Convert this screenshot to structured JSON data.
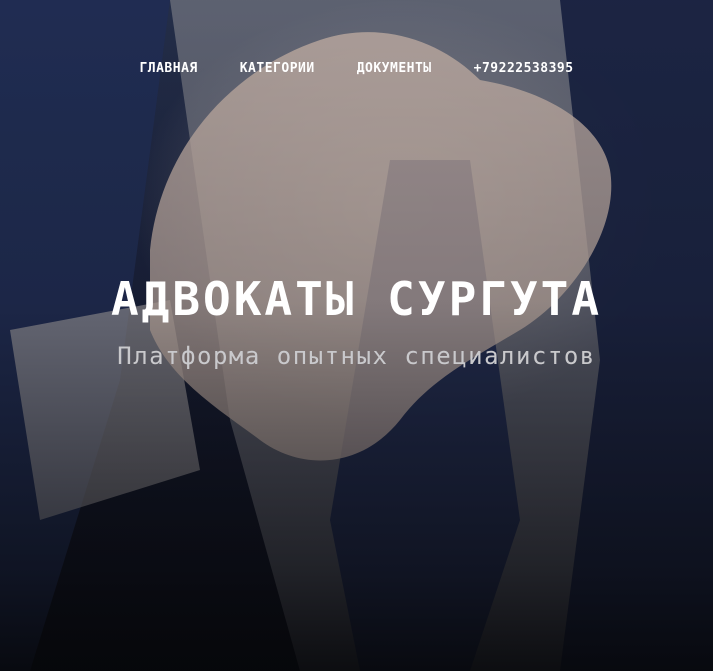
{
  "nav": {
    "items": [
      {
        "label": "ГЛАВНАЯ"
      },
      {
        "label": "КАТЕГОРИИ"
      },
      {
        "label": "ДОКУМЕНТЫ"
      },
      {
        "label": "+79222538395"
      }
    ]
  },
  "hero": {
    "title": "АДВОКАТЫ СУРГУТА",
    "subtitle": "Платформа опытных специалистов"
  },
  "colors": {
    "text_primary": "#ffffff",
    "text_secondary": "#c9c9cc",
    "suit": "#24305a",
    "background_dark": "#0b0c14"
  }
}
